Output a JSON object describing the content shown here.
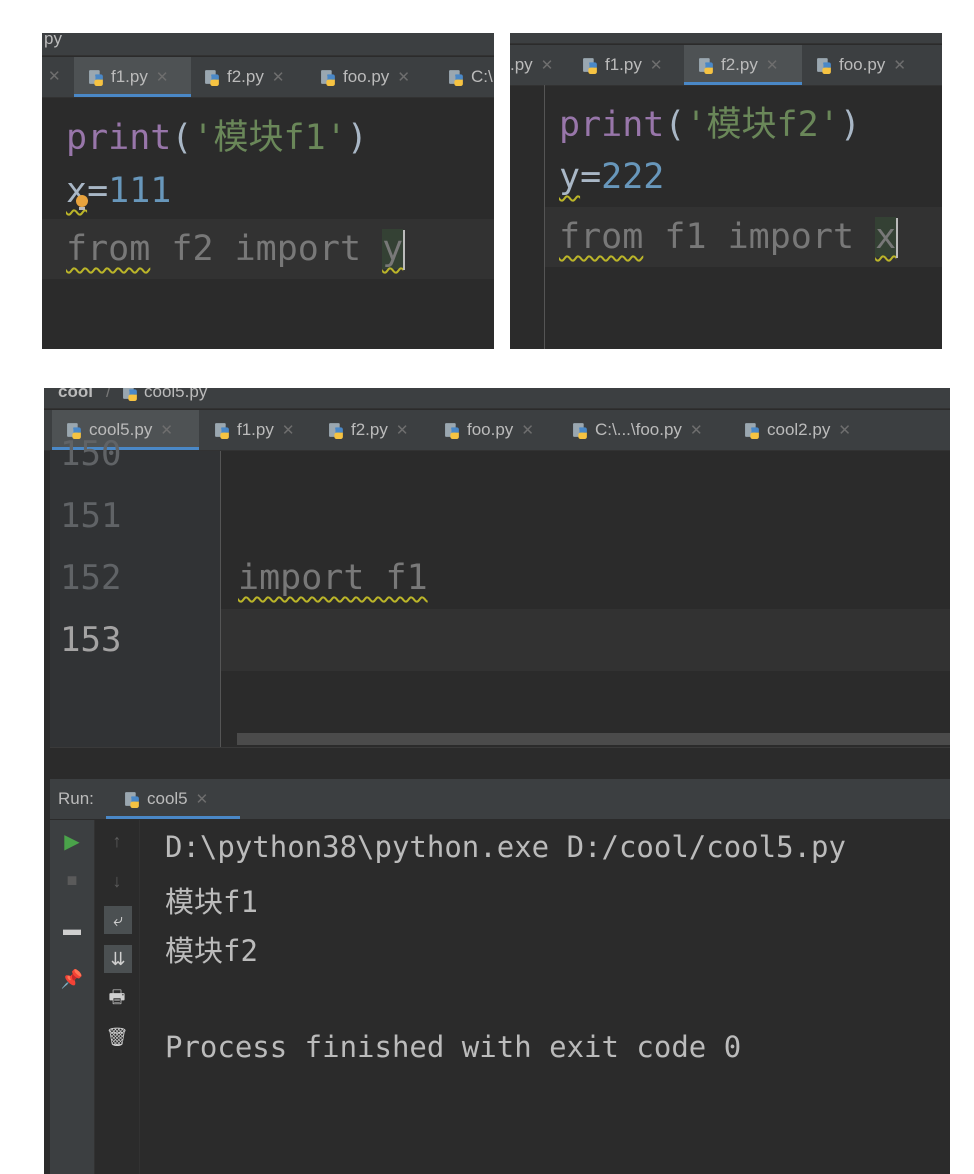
{
  "colors": {
    "editor_bg": "#2b2b2b",
    "tabbar_bg": "#3c3f41",
    "active_tab_underline": "#4a88c7",
    "keyword": "#cc7832",
    "function": "#9876aa",
    "string": "#6a8759",
    "number": "#6897bb",
    "warning_squiggle": "#bbb529",
    "run_green": "#4aa34a"
  },
  "panel1": {
    "breadcrumb": "py",
    "tabs": [
      {
        "label": "f1.py",
        "active": true
      },
      {
        "label": "f2.py"
      },
      {
        "label": "foo.py"
      },
      {
        "label": "C:\\"
      }
    ],
    "code": {
      "l1_print": "print",
      "l1_open": "(",
      "l1_str": "'模块f1'",
      "l1_close": ")",
      "l2_var": "x",
      "l2_eq": "=",
      "l2_num": "111",
      "l3_from": "from",
      "l3_mod": " f2 ",
      "l3_import": "import",
      "l3_name": "y"
    }
  },
  "panel2": {
    "tabs": [
      {
        "label": ".py"
      },
      {
        "label": "f1.py"
      },
      {
        "label": "f2.py",
        "active": true
      },
      {
        "label": "foo.py"
      }
    ],
    "code": {
      "l1_print": "print",
      "l1_open": "(",
      "l1_str": "'模块f2'",
      "l1_close": ")",
      "l2_var": "y",
      "l2_eq": "=",
      "l2_num": "222",
      "l3_from": "from",
      "l3_mod": " f1 ",
      "l3_import": "import",
      "l3_name": "x"
    }
  },
  "panel3": {
    "breadcrumb_project": "cool",
    "breadcrumb_file": "cool5.py",
    "tabs": [
      {
        "label": "cool5.py",
        "active": true
      },
      {
        "label": "f1.py"
      },
      {
        "label": "f2.py"
      },
      {
        "label": "foo.py"
      },
      {
        "label": "C:\\...\\foo.py"
      },
      {
        "label": "cool2.py"
      }
    ],
    "line_numbers": [
      "150",
      "151",
      "152",
      "153"
    ],
    "code_line_152": "import f1",
    "run": {
      "label": "Run:",
      "config_name": "cool5",
      "output": [
        "D:\\python38\\python.exe D:/cool/cool5.py",
        "模块f1",
        "模块f2",
        "",
        "Process finished with exit code 0"
      ]
    }
  },
  "icons": [
    "python-file-icon",
    "close-icon",
    "lightbulb-icon",
    "run-icon",
    "stop-icon",
    "layout-icon",
    "pin-icon",
    "up-arrow-icon",
    "down-arrow-icon",
    "soft-wrap-icon",
    "scroll-to-end-icon",
    "print-icon",
    "trash-icon"
  ]
}
